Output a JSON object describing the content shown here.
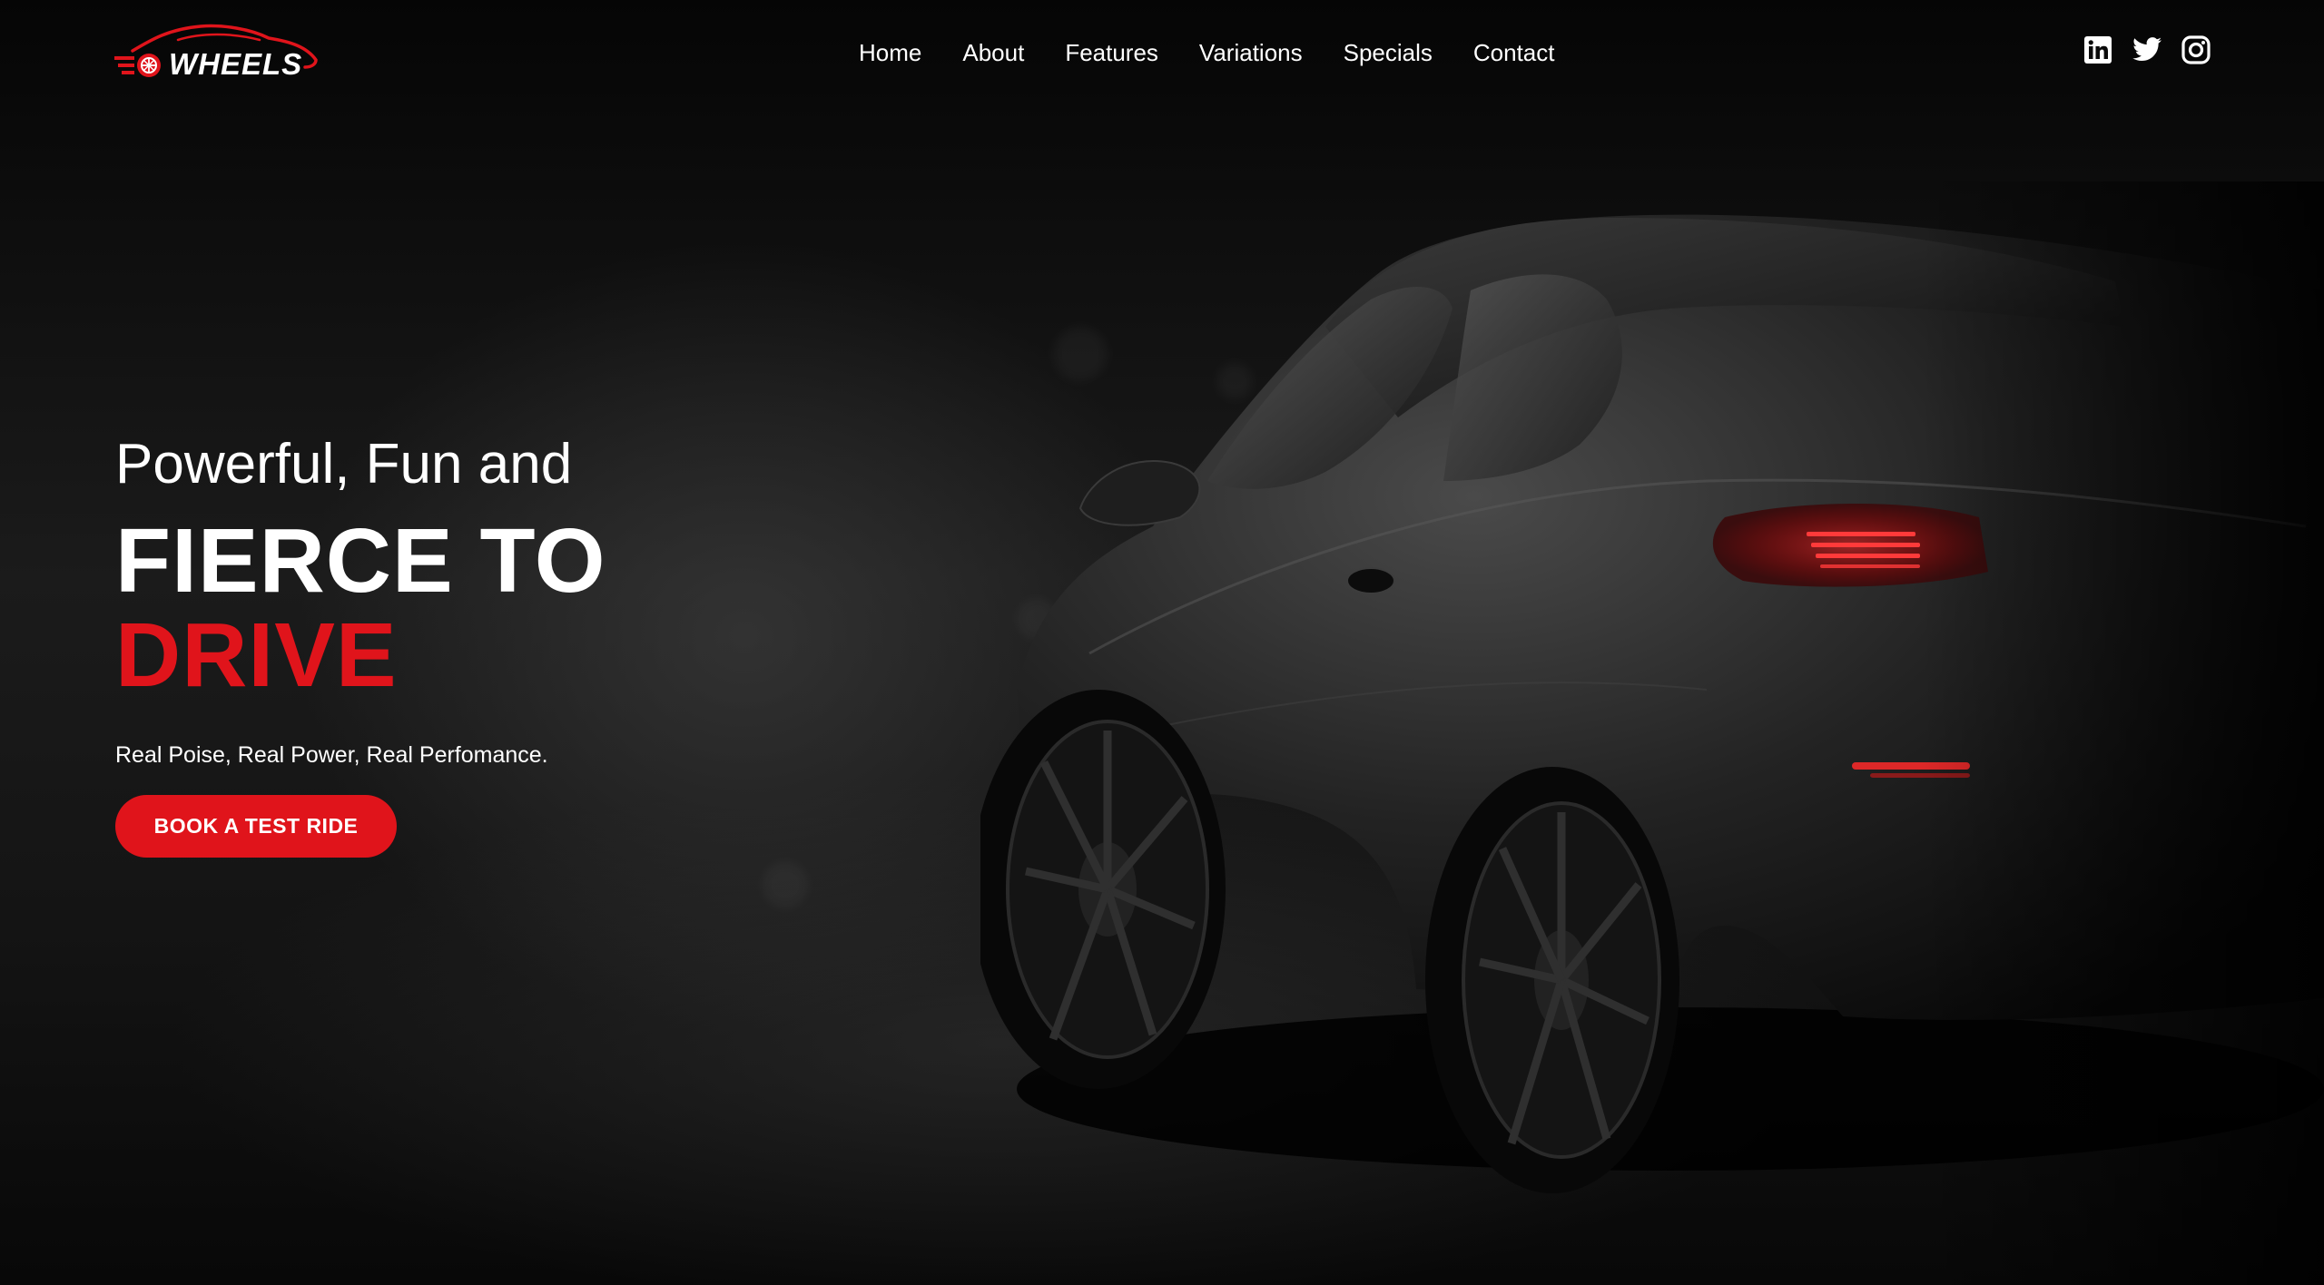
{
  "brand": {
    "name": "WHEELS",
    "accent_color": "#e0141b"
  },
  "nav": {
    "links": [
      {
        "label": "Home"
      },
      {
        "label": "About"
      },
      {
        "label": "Features"
      },
      {
        "label": "Variations"
      },
      {
        "label": "Specials"
      },
      {
        "label": "Contact"
      }
    ]
  },
  "social": {
    "icons": [
      "linkedin-icon",
      "twitter-icon",
      "instagram-icon"
    ]
  },
  "hero": {
    "pre_title": "Powerful, Fun and",
    "title_line1": "FIERCE TO",
    "title_line2": "DRIVE",
    "tagline": "Real Poise, Real Power, Real Perfomance.",
    "cta_label": "BOOK A TEST RIDE"
  },
  "colors": {
    "background": "#0a0a0a",
    "text": "#ffffff",
    "accent": "#e0141b"
  }
}
